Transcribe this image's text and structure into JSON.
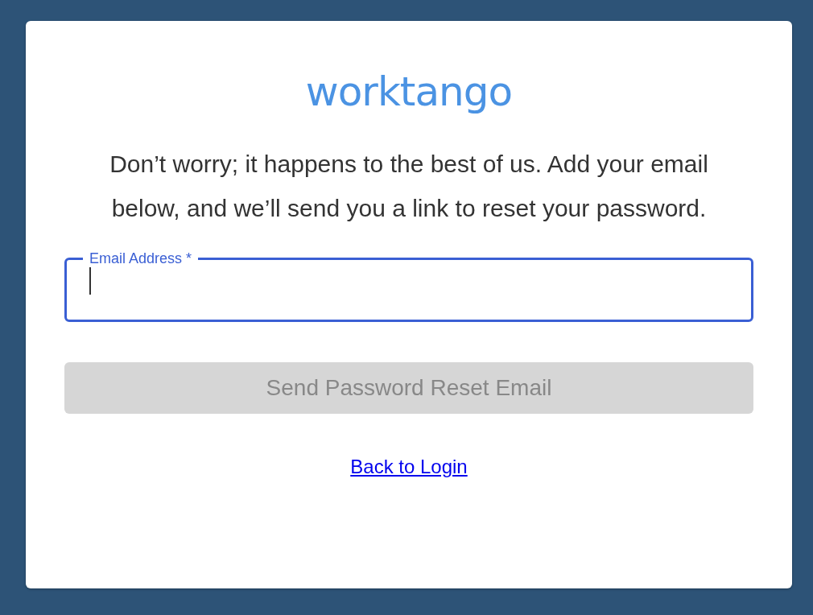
{
  "logo": "worktango",
  "message": "Don’t worry; it happens to the best of us. Add your email below, and we’ll send you a link to reset your password.",
  "email_field": {
    "label": "Email Address *",
    "focused": true
  },
  "submit_button": {
    "label": "Send Password Reset Email",
    "disabled": true
  },
  "back_link": "Back to Login"
}
